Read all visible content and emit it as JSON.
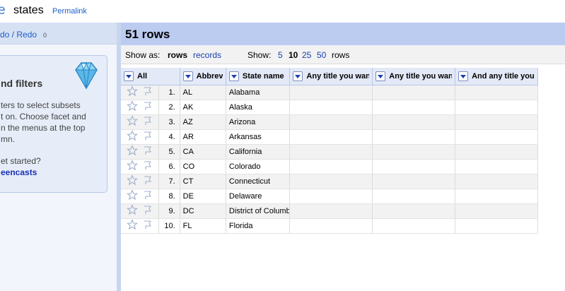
{
  "header": {
    "logo_fragment": "e",
    "project_name": "states",
    "permalink_label": "Permalink"
  },
  "left_panel": {
    "undo_label": "do / Redo",
    "undo_count": "0",
    "facet": {
      "title": "nd filters",
      "text_lines": [
        "ters to select subsets",
        "t on. Choose facet and",
        "n the menus at the top",
        "mn."
      ],
      "get_started": "et started?",
      "screencasts_link": "eencasts"
    }
  },
  "summary": {
    "row_count": "51 rows"
  },
  "view_bar": {
    "show_as_label": "Show as:",
    "mode_rows": "rows",
    "mode_records": "records",
    "show_label": "Show:",
    "page_sizes": [
      "5",
      "10",
      "25",
      "50"
    ],
    "page_suffix": "rows",
    "selected_page_size": "10"
  },
  "table": {
    "all_label": "All",
    "columns": [
      "Abbrev",
      "State name",
      "Any title you want",
      "Any title you want",
      "And any title you"
    ],
    "rows": [
      {
        "n": "1.",
        "abbrev": "AL",
        "state": "Alabama"
      },
      {
        "n": "2.",
        "abbrev": "AK",
        "state": "Alaska"
      },
      {
        "n": "3.",
        "abbrev": "AZ",
        "state": "Arizona"
      },
      {
        "n": "4.",
        "abbrev": "AR",
        "state": "Arkansas"
      },
      {
        "n": "5.",
        "abbrev": "CA",
        "state": "California"
      },
      {
        "n": "6.",
        "abbrev": "CO",
        "state": "Colorado"
      },
      {
        "n": "7.",
        "abbrev": "CT",
        "state": "Connecticut"
      },
      {
        "n": "8.",
        "abbrev": "DE",
        "state": "Delaware"
      },
      {
        "n": "9.",
        "abbrev": "DC",
        "state": "District of Columbia"
      },
      {
        "n": "10.",
        "abbrev": "FL",
        "state": "Florida"
      }
    ]
  },
  "colors": {
    "link": "#1a5fc6",
    "summary_bar": "#bccbf0",
    "header_row": "#e3e9f7"
  }
}
